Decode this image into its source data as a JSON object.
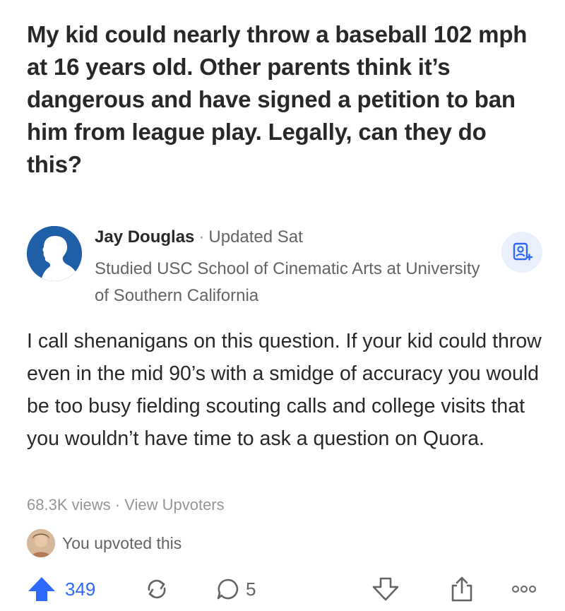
{
  "question": {
    "title": "My kid could nearly throw a baseball 102 mph at 16 years old. Other parents think it’s dangerous and have signed a petition to ban him from league play. Legally, can they do this?"
  },
  "answer": {
    "author_name": "Jay Douglas",
    "separator": "·",
    "updated": "Updated Sat",
    "credential": "Studied USC School of Cinematic Arts at University of Southern California",
    "body": "I call shenanigans on this question. If your kid could throw even in the mid 90’s with a smidge of accuracy you would be too busy fielding scouting calls and college visits that you wouldn’t have time to ask a question on Quora.",
    "views": "68.3K views",
    "meta_separator": "·",
    "view_upvoters": "View Upvoters",
    "upvoted_text": "You upvoted this"
  },
  "actions": {
    "upvote_count": "349",
    "comment_count": "5"
  },
  "colors": {
    "accent": "#2e69ff",
    "avatar_bg": "#1f5fa8",
    "text": "#282829",
    "muted": "#636466"
  }
}
